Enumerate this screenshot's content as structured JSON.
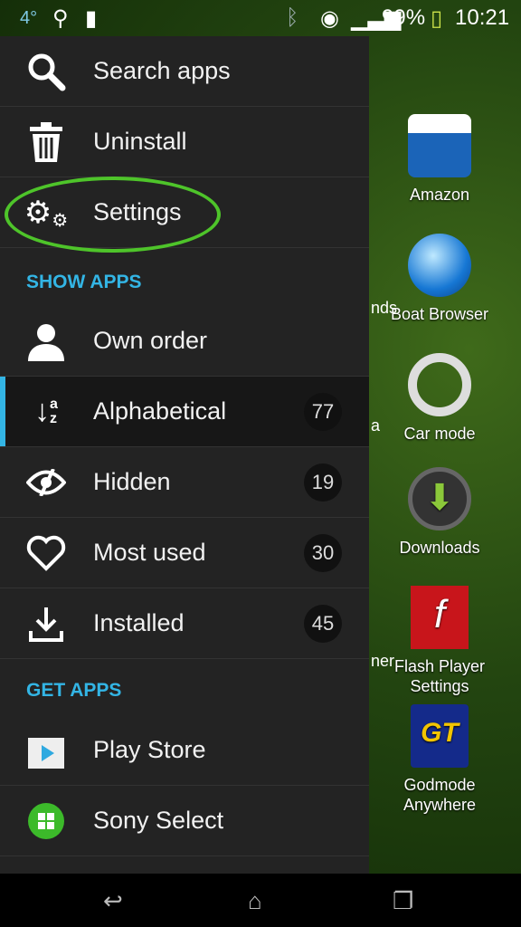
{
  "status_bar": {
    "temperature": "4°",
    "battery": "99%",
    "time": "10:21",
    "icons": [
      "usb-icon",
      "android-icon",
      "bluetooth-icon",
      "wifi-icon",
      "signal-icon",
      "battery-charging-icon"
    ]
  },
  "menu": {
    "actions": [
      {
        "label": "Search apps",
        "icon": "search-icon"
      },
      {
        "label": "Uninstall",
        "icon": "trash-icon"
      },
      {
        "label": "Settings",
        "icon": "gears-icon"
      }
    ],
    "show_apps_header": "SHOW APPS",
    "show_apps": [
      {
        "label": "Own order",
        "icon": "person-icon"
      },
      {
        "label": "Alphabetical",
        "icon": "sort-az-icon",
        "count": "77",
        "selected": true
      },
      {
        "label": "Hidden",
        "icon": "eye-slash-icon",
        "count": "19"
      },
      {
        "label": "Most used",
        "icon": "heart-icon",
        "count": "30"
      },
      {
        "label": "Installed",
        "icon": "download-icon",
        "count": "45"
      }
    ],
    "get_apps_header": "GET APPS",
    "get_apps": [
      {
        "label": "Play Store",
        "icon": "play-store-icon"
      },
      {
        "label": "Sony Select",
        "icon": "sony-select-icon"
      }
    ],
    "accent": "#33b5e5",
    "highlight": "#4ec42a"
  },
  "apps": [
    {
      "label": "Amazon"
    },
    {
      "label": "Boat Browser"
    },
    {
      "label": "Car mode"
    },
    {
      "label": "Downloads"
    },
    {
      "label": "Flash Player Settings"
    },
    {
      "label": "Godmode Anywhere"
    }
  ],
  "partial_labels": [
    "nds",
    "a",
    "ner"
  ]
}
